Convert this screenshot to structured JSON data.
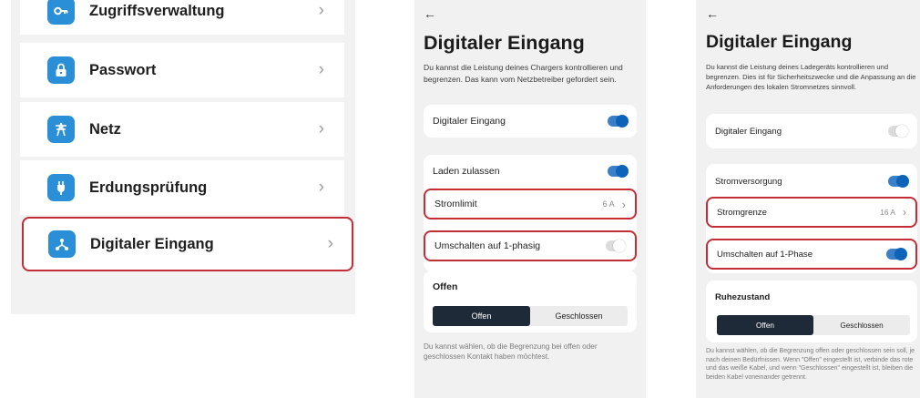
{
  "colors": {
    "accent": "#2a8fd6",
    "toggle_on": "#0d63b8",
    "highlight": "#c42d35",
    "segment_active": "#1f2a38"
  },
  "settings_list": {
    "items": [
      {
        "label": "Zugriffsverwaltung",
        "icon": "key-icon"
      },
      {
        "label": "Passwort",
        "icon": "lock-icon"
      },
      {
        "label": "Netz",
        "icon": "power-pylon-icon"
      },
      {
        "label": "Erdungsprüfung",
        "icon": "plug-icon"
      },
      {
        "label": "Digitaler Eingang",
        "icon": "connection-nodes-icon",
        "highlighted": true
      }
    ],
    "chevron": "›"
  },
  "screen_a": {
    "back": "←",
    "title": "Digitaler Eingang",
    "description": "Du kannst die Leistung deines Chargers kontrollieren und begrenzen. Das kann vom Netzbetreiber gefordert sein.",
    "digital_input": {
      "label": "Digitaler Eingang",
      "toggle": "on"
    },
    "allow_charging": {
      "label": "Laden zulassen",
      "toggle": "on"
    },
    "current_limit": {
      "label": "Stromlimit",
      "value": "6 A",
      "chevron": "›"
    },
    "single_phase": {
      "label": "Umschalten auf 1-phasig",
      "toggle": "off"
    },
    "mode": {
      "heading": "Offen",
      "options": [
        "Offen",
        "Geschlossen"
      ],
      "selected": "Offen"
    },
    "footer": "Du kannst wählen, ob die Begrenzung bei offen oder geschlossen Kontakt haben möchtest."
  },
  "screen_b": {
    "back": "←",
    "title": "Digitaler Eingang",
    "description": "Du kannst die Leistung deines Ladegeräts kontrollieren und begrenzen. Dies ist für Sicherheitszwecke und die Anpassung an die Anforderungen des lokalen Stromnetzes sinnvoll.",
    "digital_input": {
      "label": "Digitaler Eingang",
      "toggle": "off"
    },
    "power_supply": {
      "label": "Stromversorgung",
      "toggle": "on"
    },
    "current_limit": {
      "label": "Stromgrenze",
      "value": "16 A",
      "chevron": "›"
    },
    "single_phase": {
      "label": "Umschalten auf 1-Phase",
      "toggle": "on"
    },
    "mode": {
      "heading": "Ruhezustand",
      "options": [
        "Offen",
        "Geschlossen"
      ],
      "selected": "Offen"
    },
    "footer": "Du kannst wählen, ob die Begrenzung offen oder geschlossen sein soll, je nach deinen Bedürfnissen. Wenn \"Offen\" eingestellt ist, verbinde das rote und das weiße Kabel, und wenn \"Geschlossen\" eingestellt ist, bleiben die beiden Kabel voneinander getrennt."
  }
}
